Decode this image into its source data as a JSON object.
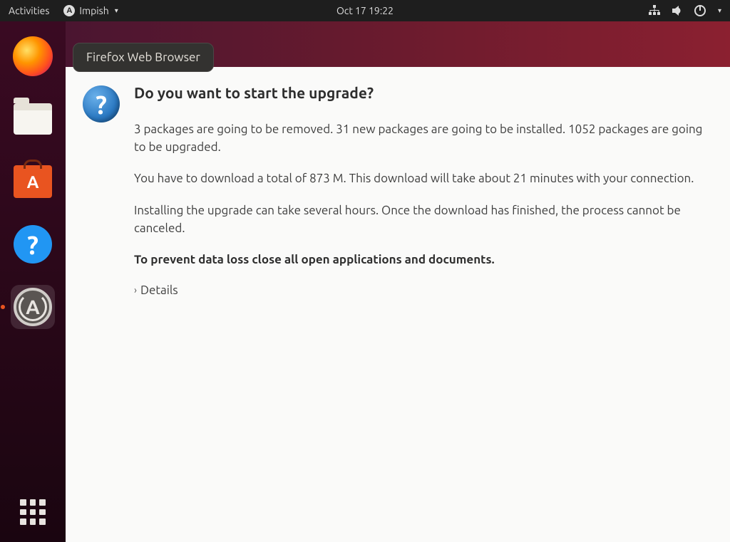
{
  "topbar": {
    "activities": "Activities",
    "app_name": "Impish",
    "clock": "Oct 17  19:22"
  },
  "tooltip": {
    "text": "Firefox Web Browser"
  },
  "dock": {
    "items": [
      {
        "name": "firefox"
      },
      {
        "name": "files"
      },
      {
        "name": "software-center"
      },
      {
        "name": "help"
      },
      {
        "name": "software-updater"
      }
    ]
  },
  "dialog": {
    "title": "Do you want to start the upgrade?",
    "p1": "3 packages are going to be removed. 31 new packages are going to be installed. 1052 packages are going to be upgraded.",
    "p2": "You have to download a total of 873 M. This download will take about 21 minutes with your connection.",
    "p3": "Installing the upgrade can take several hours. Once the download has finished, the process cannot be canceled.",
    "warning": "To prevent data loss close all open applications and documents.",
    "details_label": "Details"
  }
}
